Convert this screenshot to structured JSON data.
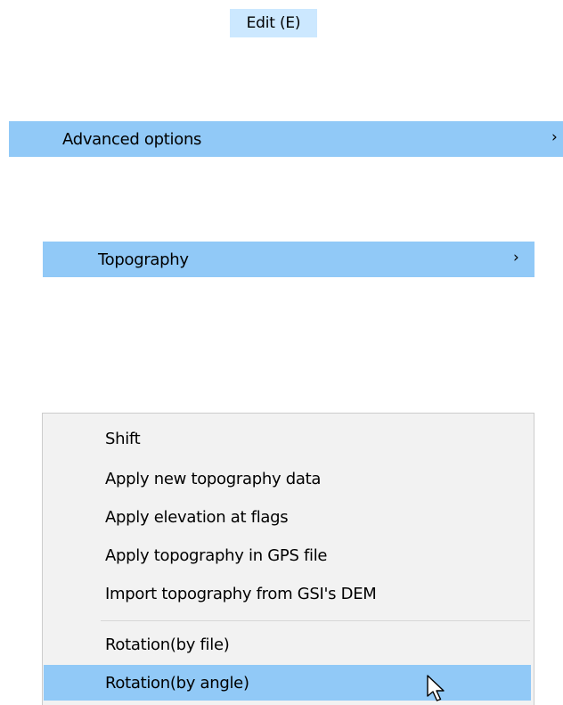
{
  "edit_menu": {
    "title": "Edit (E)"
  },
  "advanced_options": {
    "label": "Advanced options",
    "chevron": "›"
  },
  "topography": {
    "label": "Topography",
    "chevron": "›"
  },
  "topography_submenu": {
    "group1": [
      "Shift",
      "Apply new topography data",
      "Apply elevation at flags",
      "Apply topography in GPS file",
      "Import topography from GSI's DEM"
    ],
    "group2": [
      "Rotation(by file)",
      "Rotation(by angle)"
    ],
    "selected": "Rotation(by angle)"
  },
  "icons": {
    "cursor": "mouse-pointer-icon"
  },
  "colors": {
    "menu_title_highlight": "#cce8ff",
    "item_highlight": "#91c9f7",
    "submenu_background": "#f2f2f2",
    "separator": "#d7d7d7"
  }
}
